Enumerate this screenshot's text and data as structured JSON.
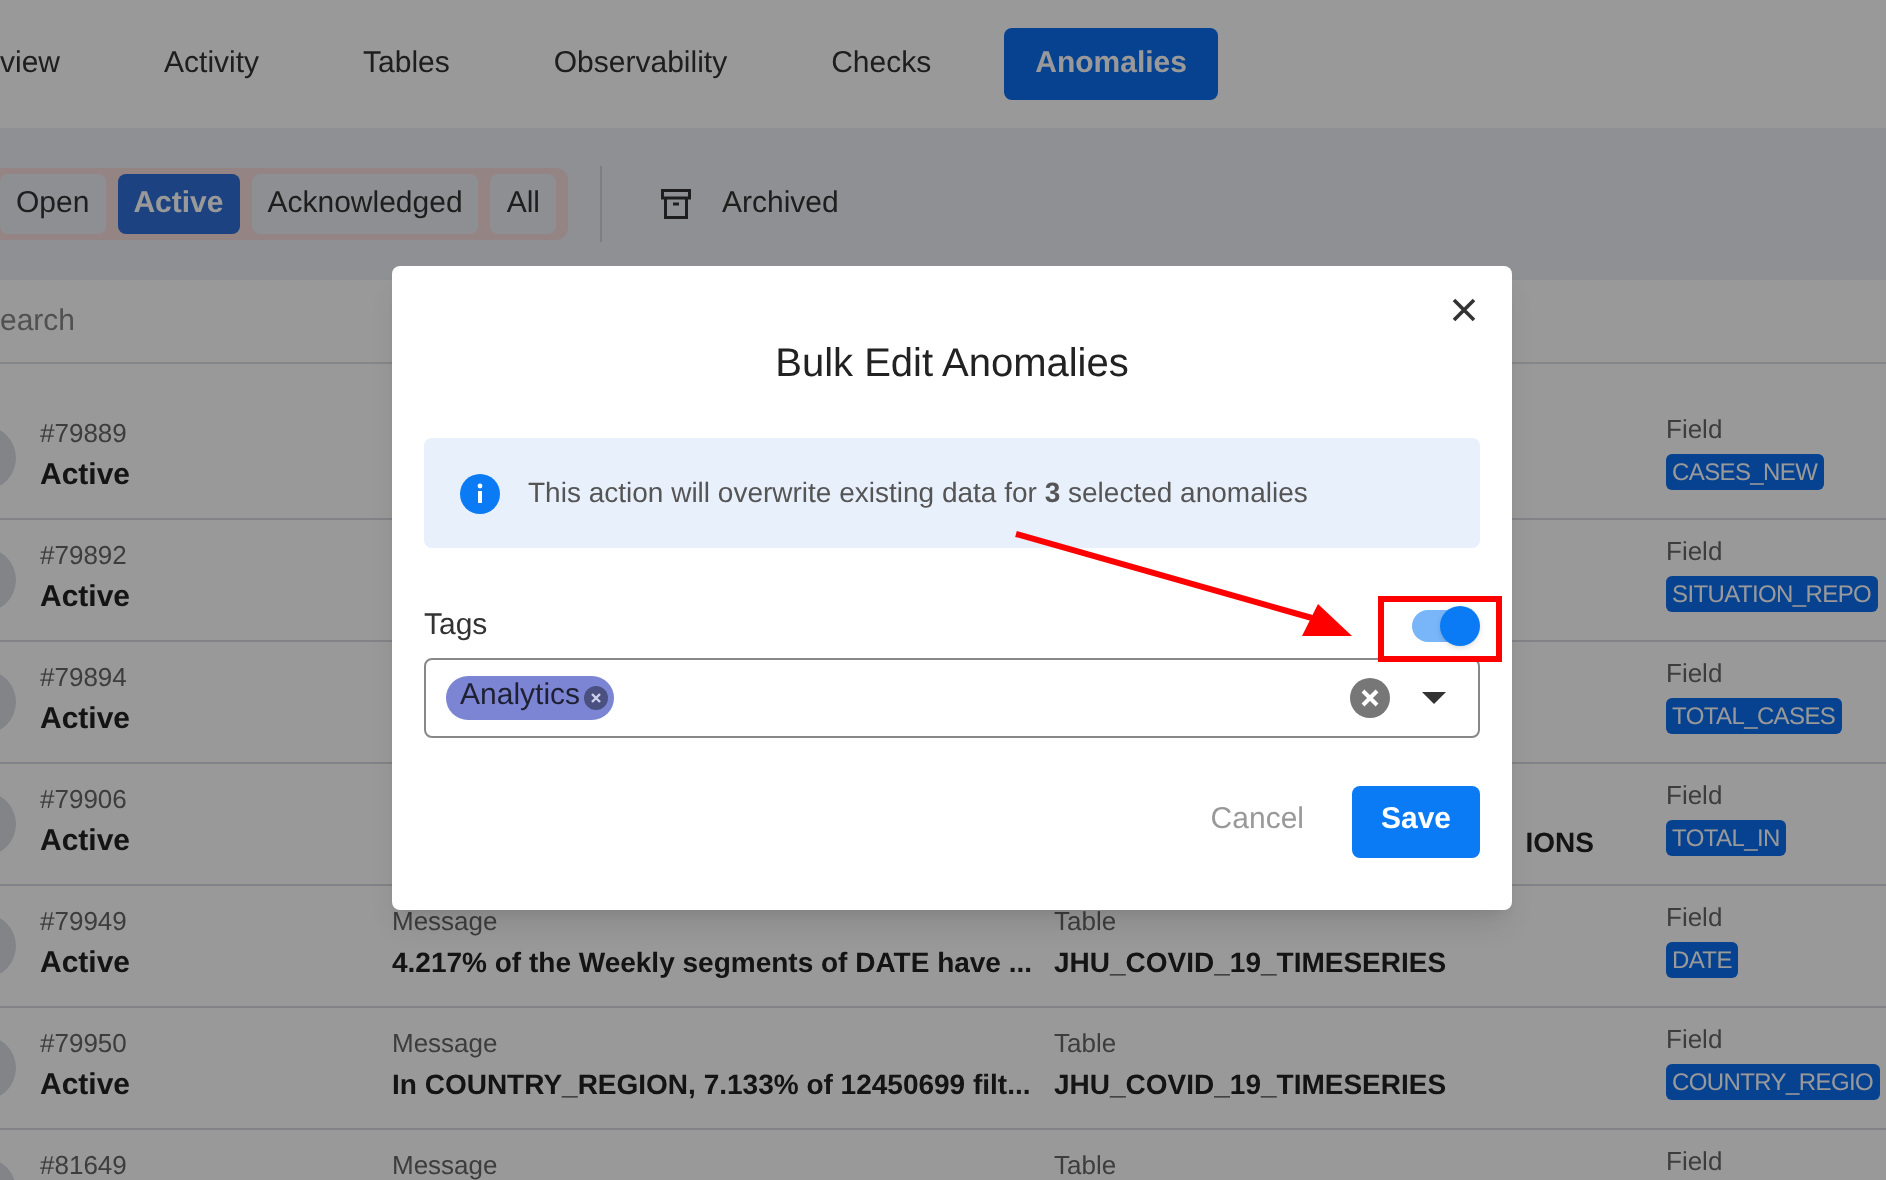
{
  "tabs": [
    {
      "label": "view",
      "selected": false
    },
    {
      "label": "Activity",
      "selected": false
    },
    {
      "label": "Tables",
      "selected": false
    },
    {
      "label": "Observability",
      "selected": false
    },
    {
      "label": "Checks",
      "selected": false
    },
    {
      "label": "Anomalies",
      "selected": true
    }
  ],
  "filters": [
    {
      "label": "Open",
      "selected": false
    },
    {
      "label": "Active",
      "selected": true
    },
    {
      "label": "Acknowledged",
      "selected": false
    },
    {
      "label": "All",
      "selected": false
    }
  ],
  "archived_label": "Archived",
  "search": {
    "placeholder": "earch"
  },
  "rows": [
    {
      "id": "#79889",
      "status": "Active",
      "field_label": "Field",
      "field": "CASES_NEW"
    },
    {
      "id": "#79892",
      "status": "Active",
      "field_label": "Field",
      "field": "SITUATION_REPO"
    },
    {
      "id": "#79894",
      "status": "Active",
      "field_label": "Field",
      "field": "TOTAL_CASES"
    },
    {
      "id": "#79906",
      "status": "Active",
      "table": "IONS",
      "field_label": "Field",
      "field": "TOTAL_IN"
    },
    {
      "id": "#79949",
      "status": "Active",
      "message_label": "Message",
      "message": "4.217% of the Weekly segments of DATE have ...",
      "table_label": "Table",
      "table": "JHU_COVID_19_TIMESERIES",
      "field_label": "Field",
      "field": "DATE"
    },
    {
      "id": "#79950",
      "status": "Active",
      "message_label": "Message",
      "message": "In COUNTRY_REGION, 7.133% of 12450699 filt...",
      "table_label": "Table",
      "table": "JHU_COVID_19_TIMESERIES",
      "field_label": "Field",
      "field": "COUNTRY_REGIO"
    },
    {
      "id": "#81649",
      "message_label": "Message",
      "table_label": "Table",
      "field_label": "Field"
    }
  ],
  "modal": {
    "title": "Bulk Edit Anomalies",
    "info": "This action will overwrite existing data for **3** selected anomalies",
    "tags_label": "Tags",
    "tags_toggle_on": true,
    "tags": [
      "Analytics"
    ],
    "cancel": "Cancel",
    "save": "Save"
  }
}
